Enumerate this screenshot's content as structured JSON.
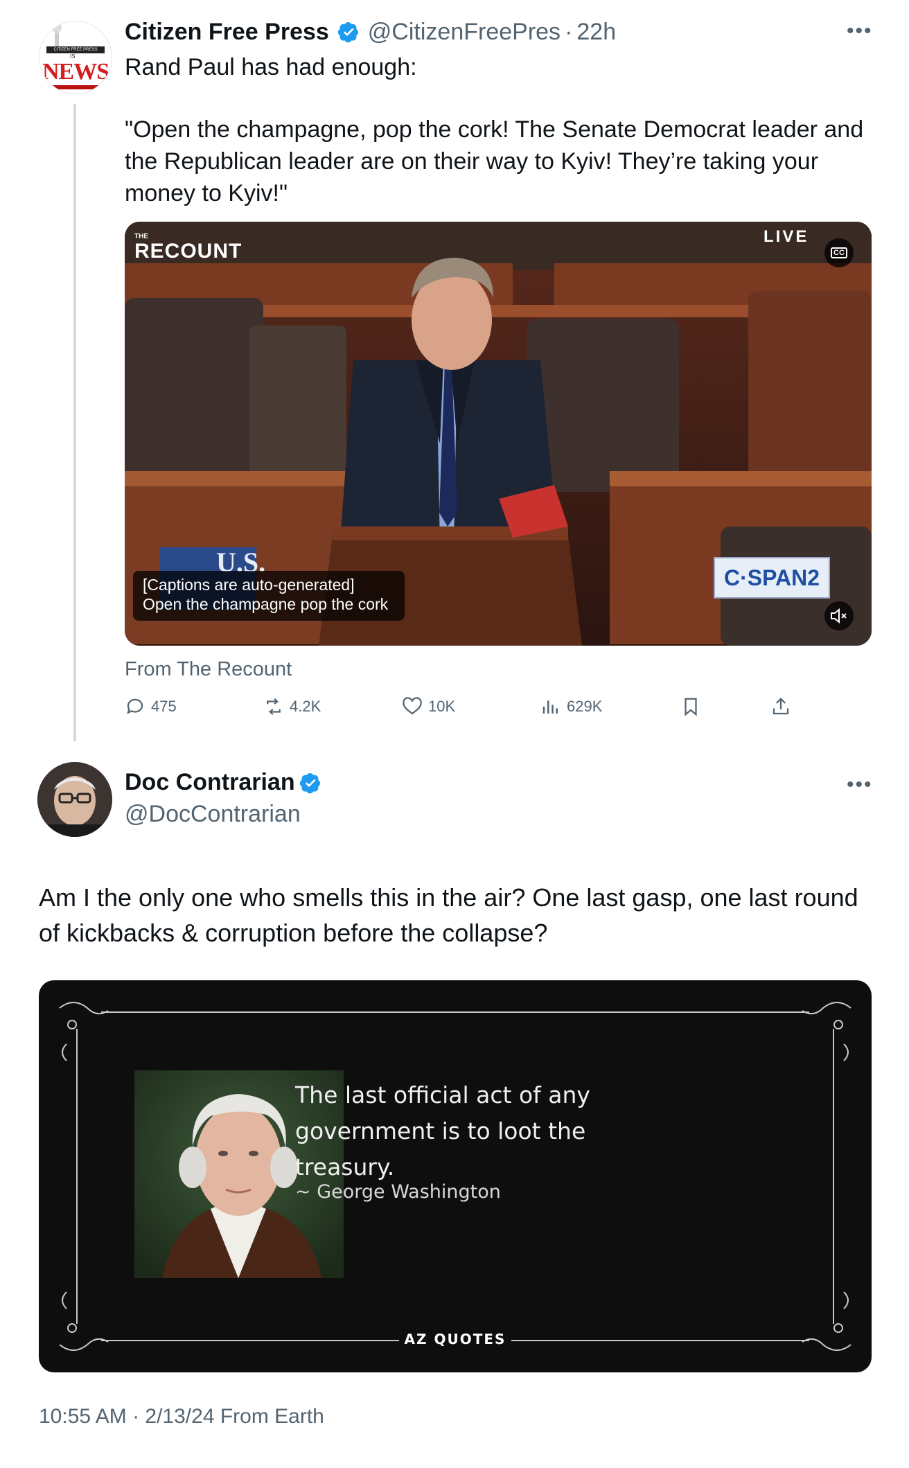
{
  "tweet1": {
    "author_name": "Citizen Free Press",
    "handle": "@CitizenFreePres",
    "separator": "·",
    "time": "22h",
    "avatar_text": "NEWS",
    "avatar_banner": "CITIZEN FREE PRESS",
    "avatar_is": "IS",
    "text_line1": "Rand Paul has had enough:",
    "text_quote": "\"Open the champagne, pop the cork! The Senate Democrat leader and the Republican leader are on their way to Kyiv! They’re taking your money to Kyiv!\"",
    "video": {
      "brand_small": "THE",
      "brand": "RECOUNT",
      "live_label": "LIVE",
      "cc_label": "CC",
      "network": "C·SPAN2",
      "us_label": "U.S.",
      "caption_line1": "[Captions are auto-generated]",
      "caption_line2": "Open the champagne pop the cork"
    },
    "source": "From The Recount",
    "stats": {
      "replies": "475",
      "reposts": "4.2K",
      "likes": "10K",
      "views": "629K"
    }
  },
  "tweet2": {
    "author_name": "Doc Contrarian",
    "handle": "@DocContrarian",
    "text": "Am I the only one who smells this in the air? One last gasp, one last round of kickbacks & corruption before the collapse?",
    "quote_card": {
      "quote": "The last official act of any government is to loot the treasury.",
      "attribution": "~ George Washington",
      "brand": "AZ QUOTES"
    },
    "timestamp": "10:55 AM · 2/13/24 From Earth"
  },
  "colors": {
    "verified": "#1d9bf0",
    "muted": "#536471",
    "divider": "#cfd9de",
    "card_bg": "#0e0e0e"
  }
}
